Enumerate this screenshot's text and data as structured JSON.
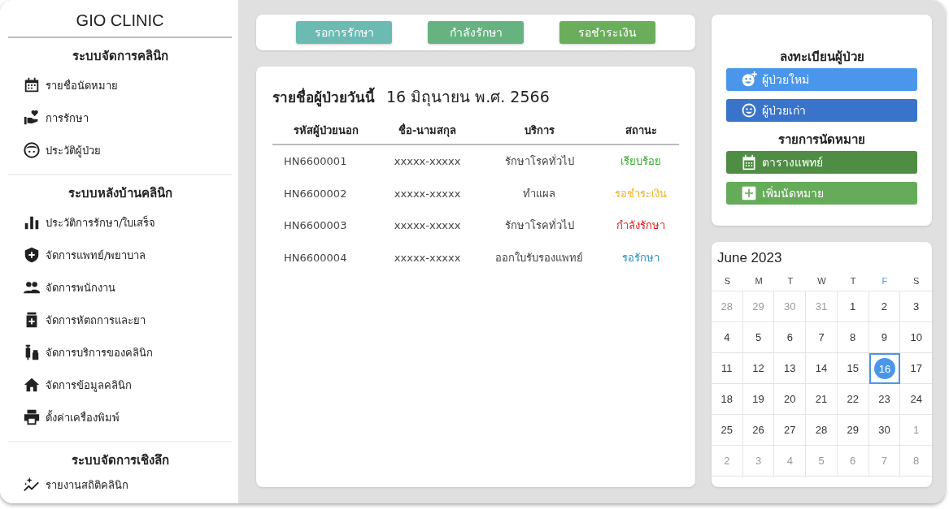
{
  "sidebar": {
    "title": "GIO CLINIC",
    "sections": [
      {
        "heading": "ระบบจัดการคลินิก",
        "items": [
          {
            "label": "รายชื่อนัดหมาย",
            "kind": "calendar"
          },
          {
            "label": "การรักษา",
            "kind": "care"
          },
          {
            "label": "ประวัติผู้ป่วย",
            "kind": "face"
          }
        ]
      },
      {
        "heading": "ระบบหลังบ้านคลินิก",
        "items": [
          {
            "label": "ประวัติการรักษา/ใบเสร็จ",
            "kind": "bars"
          },
          {
            "label": "จัดการแพทย์/พยาบาล",
            "kind": "shield"
          },
          {
            "label": "จัดการพนักงาน",
            "kind": "people"
          },
          {
            "label": "จัดการหัตถการและยา",
            "kind": "medicine"
          },
          {
            "label": "จัดการบริการของคลินิก",
            "kind": "vaccine"
          },
          {
            "label": "จัดการข้อมูลคลินิก",
            "kind": "house"
          },
          {
            "label": "ตั้งค่าเครื่องพิมพ์",
            "kind": "printer"
          }
        ]
      },
      {
        "heading": "ระบบจัดการเชิงลึก",
        "items": [
          {
            "label": "รายงานสถิติคลินิก",
            "kind": "sparkle"
          }
        ]
      }
    ]
  },
  "status_buttons": [
    {
      "label": "รอการรักษา",
      "color": "#6cbbb3"
    },
    {
      "label": "กำลังรักษา",
      "color": "#66b281"
    },
    {
      "label": "รอชำระเงิน",
      "color": "#6aae5c"
    }
  ],
  "patients": {
    "title": "รายชื่อผู้ป่วยวันนี้",
    "date": "16 มิถุนายน พ.ศ. 2566",
    "columns": [
      "รหัสผู้ป่วยนอก",
      "ชื่อ-นามสกุล",
      "บริการ",
      "สถานะ"
    ],
    "rows": [
      {
        "id": "HN6600001",
        "name": "xxxxx-xxxxx",
        "service": "รักษาโรคทั่วไป",
        "status": "เรียบร้อย",
        "color": "#3aaa35"
      },
      {
        "id": "HN6600002",
        "name": "xxxxx-xxxxx",
        "service": "ทำแผล",
        "status": "รอชำระเงิน",
        "color": "#f0b429"
      },
      {
        "id": "HN6600003",
        "name": "xxxxx-xxxxx",
        "service": "รักษาโรคทั่วไป",
        "status": "กำลังรักษา",
        "color": "#e8201e"
      },
      {
        "id": "HN6600004",
        "name": "xxxxx-xxxxx",
        "service": "ออกใบรับรองแพทย์",
        "status": "รอรักษา",
        "color": "#2a8fc7"
      }
    ]
  },
  "register": {
    "heading": "ลงทะเบียนผู้ป่วย",
    "buttons": [
      {
        "label": "ผู้ป่วยใหม่",
        "kind": "face-plus",
        "color": "#4a96ea"
      },
      {
        "label": "ผู้ป่วยเก่า",
        "kind": "face",
        "color": "#3974ca"
      }
    ]
  },
  "appointments": {
    "heading": "รายการนัดหมาย",
    "buttons": [
      {
        "label": "ตารางแพทย์",
        "kind": "calendar",
        "color": "#4e8d43"
      },
      {
        "label": "เพิ่มนัดหมาย",
        "kind": "plus",
        "color": "#66ab5a"
      }
    ]
  },
  "calendar": {
    "title": "June 2023",
    "weekdays": [
      {
        "label": "S",
        "selected": false
      },
      {
        "label": "M",
        "selected": false
      },
      {
        "label": "T",
        "selected": false
      },
      {
        "label": "W",
        "selected": false
      },
      {
        "label": "T",
        "selected": false
      },
      {
        "label": "F",
        "selected": true
      },
      {
        "label": "S",
        "selected": false
      }
    ],
    "weeks": [
      [
        {
          "day": "28",
          "muted": true,
          "selected": false
        },
        {
          "day": "29",
          "muted": true,
          "selected": false
        },
        {
          "day": "30",
          "muted": true,
          "selected": false
        },
        {
          "day": "31",
          "muted": true,
          "selected": false
        },
        {
          "day": "1",
          "muted": false,
          "selected": false
        },
        {
          "day": "2",
          "muted": false,
          "selected": false
        },
        {
          "day": "3",
          "muted": false,
          "selected": false
        }
      ],
      [
        {
          "day": "4",
          "muted": false,
          "selected": false
        },
        {
          "day": "5",
          "muted": false,
          "selected": false
        },
        {
          "day": "6",
          "muted": false,
          "selected": false
        },
        {
          "day": "7",
          "muted": false,
          "selected": false
        },
        {
          "day": "8",
          "muted": false,
          "selected": false
        },
        {
          "day": "9",
          "muted": false,
          "selected": false
        },
        {
          "day": "10",
          "muted": false,
          "selected": false
        }
      ],
      [
        {
          "day": "11",
          "muted": false,
          "selected": false
        },
        {
          "day": "12",
          "muted": false,
          "selected": false
        },
        {
          "day": "13",
          "muted": false,
          "selected": false
        },
        {
          "day": "14",
          "muted": false,
          "selected": false
        },
        {
          "day": "15",
          "muted": false,
          "selected": false
        },
        {
          "day": "16",
          "muted": false,
          "selected": true
        },
        {
          "day": "17",
          "muted": false,
          "selected": false
        }
      ],
      [
        {
          "day": "18",
          "muted": false,
          "selected": false
        },
        {
          "day": "19",
          "muted": false,
          "selected": false
        },
        {
          "day": "20",
          "muted": false,
          "selected": false
        },
        {
          "day": "21",
          "muted": false,
          "selected": false
        },
        {
          "day": "22",
          "muted": false,
          "selected": false
        },
        {
          "day": "23",
          "muted": false,
          "selected": false
        },
        {
          "day": "24",
          "muted": false,
          "selected": false
        }
      ],
      [
        {
          "day": "25",
          "muted": false,
          "selected": false
        },
        {
          "day": "26",
          "muted": false,
          "selected": false
        },
        {
          "day": "27",
          "muted": false,
          "selected": false
        },
        {
          "day": "28",
          "muted": false,
          "selected": false
        },
        {
          "day": "29",
          "muted": false,
          "selected": false
        },
        {
          "day": "30",
          "muted": false,
          "selected": false
        },
        {
          "day": "1",
          "muted": true,
          "selected": false
        }
      ],
      [
        {
          "day": "2",
          "muted": true,
          "selected": false
        },
        {
          "day": "3",
          "muted": true,
          "selected": false
        },
        {
          "day": "4",
          "muted": true,
          "selected": false
        },
        {
          "day": "5",
          "muted": true,
          "selected": false
        },
        {
          "day": "6",
          "muted": true,
          "selected": false
        },
        {
          "day": "7",
          "muted": true,
          "selected": false
        },
        {
          "day": "8",
          "muted": true,
          "selected": false
        }
      ]
    ]
  }
}
